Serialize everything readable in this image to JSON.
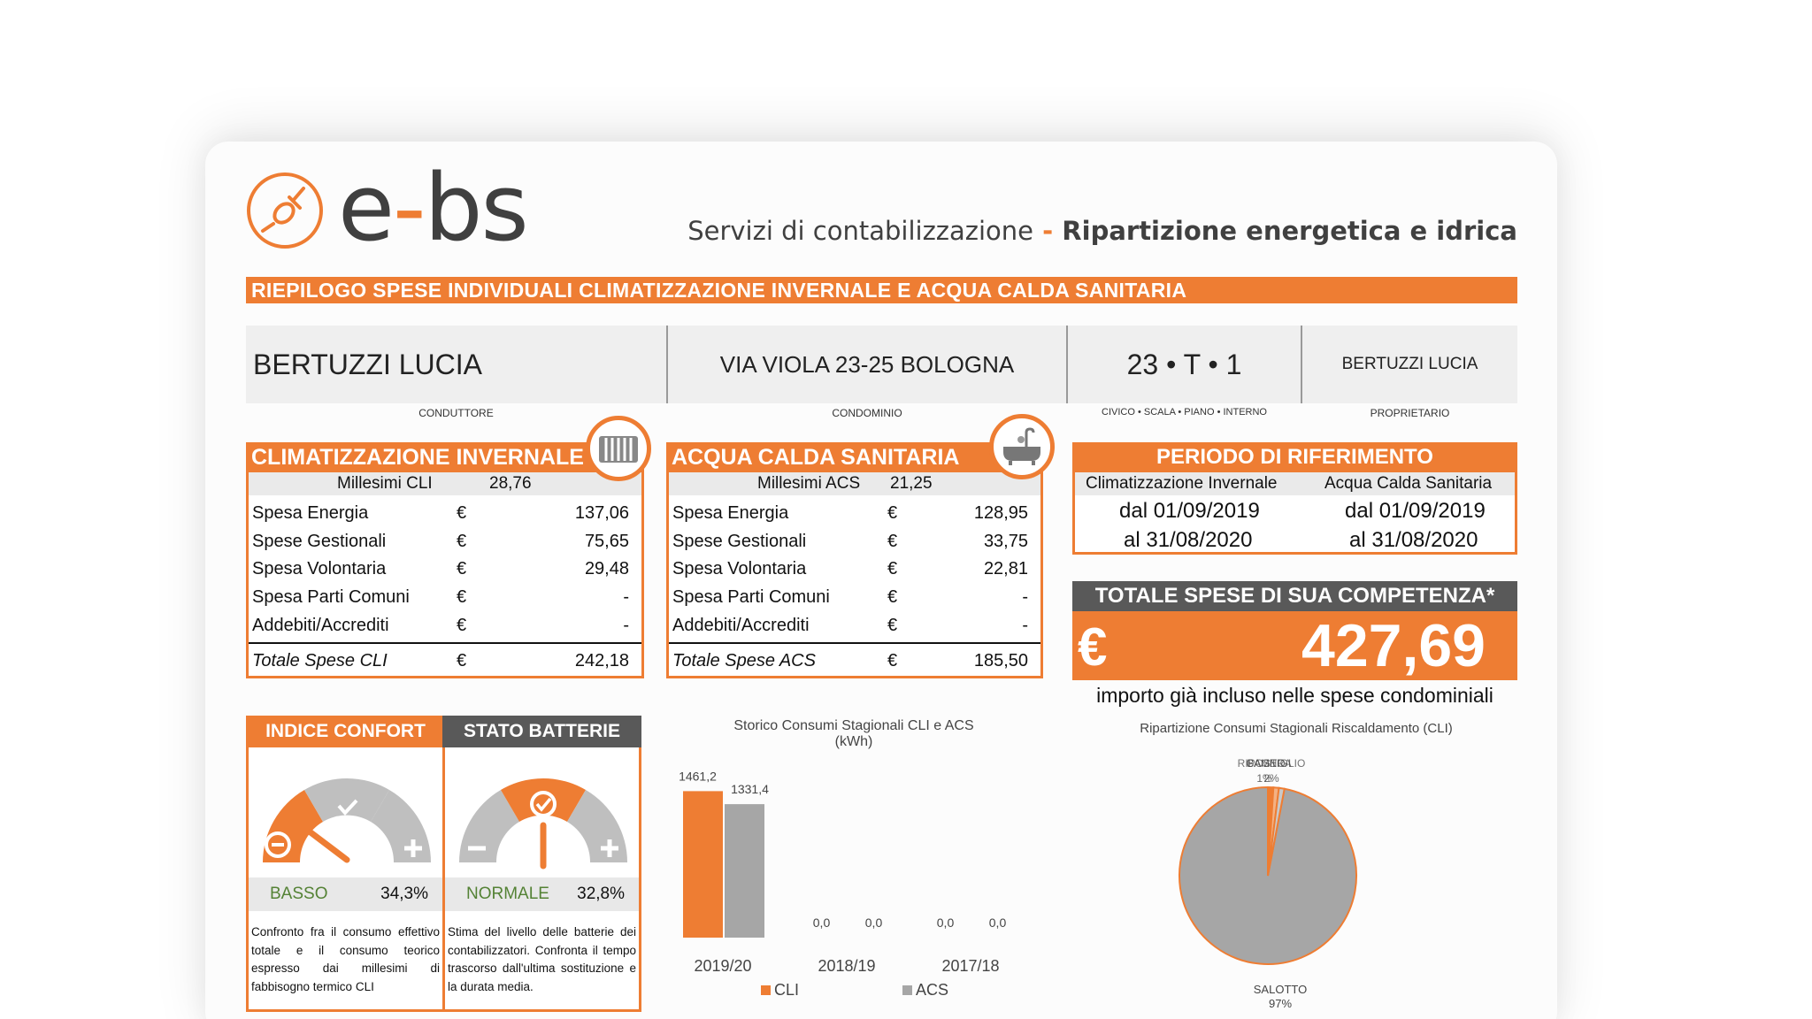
{
  "brand": {
    "logo_text": "e-bs",
    "tagline_part1": "Servizi di contabilizzazione",
    "tagline_sep": "-",
    "tagline_part2": "Ripartizione energetica e idrica"
  },
  "banner": "RIEPILOGO SPESE INDIVIDUALI CLIMATIZZAZIONE INVERNALE E ACQUA CALDA SANITARIA",
  "info": {
    "conduttore": "BERTUZZI LUCIA",
    "conduttore_label": "CONDUTTORE",
    "condominio": "VIA VIOLA 23-25 BOLOGNA",
    "condominio_label": "CONDOMINIO",
    "civico": "23 • T • 1",
    "civico_label": "CIVICO • SCALA • PIANO • INTERNO",
    "proprietario": "BERTUZZI LUCIA",
    "proprietario_label": "PROPRIETARIO"
  },
  "cli": {
    "title": "CLIMATIZZAZIONE INVERNALE",
    "icon": "radiator-icon",
    "millesimi_label": "Millesimi CLI",
    "millesimi_value": "28,76",
    "rows": [
      {
        "label": "Spesa Energia",
        "cur": "€",
        "value": "137,06"
      },
      {
        "label": "Spese Gestionali",
        "cur": "€",
        "value": "75,65"
      },
      {
        "label": "Spesa Volontaria",
        "cur": "€",
        "value": "29,48"
      },
      {
        "label": "Spesa Parti Comuni",
        "cur": "€",
        "value": "-"
      },
      {
        "label": "Addebiti/Accrediti",
        "cur": "€",
        "value": "-"
      }
    ],
    "total_label": "Totale Spese CLI",
    "total_cur": "€",
    "total_value": "242,18"
  },
  "acs": {
    "title": "ACQUA CALDA SANITARIA",
    "icon": "bathtub-icon",
    "millesimi_label": "Millesimi ACS",
    "millesimi_value": "21,25",
    "rows": [
      {
        "label": "Spesa Energia",
        "cur": "€",
        "value": "128,95"
      },
      {
        "label": "Spese Gestionali",
        "cur": "€",
        "value": "33,75"
      },
      {
        "label": "Spesa Volontaria",
        "cur": "€",
        "value": "22,81"
      },
      {
        "label": "Spesa Parti Comuni",
        "cur": "€",
        "value": "-"
      },
      {
        "label": "Addebiti/Accrediti",
        "cur": "€",
        "value": "-"
      }
    ],
    "total_label": "Totale Spese ACS",
    "total_cur": "€",
    "total_value": "185,50"
  },
  "periodo": {
    "title": "PERIODO DI RIFERIMENTO",
    "col1": "Climatizzazione Invernale",
    "col2": "Acqua Calda Sanitaria",
    "from1": "dal 01/09/2019",
    "to1": "al 31/08/2020",
    "from2": "dal 01/09/2019",
    "to2": "al 31/08/2020"
  },
  "totale": {
    "title": "TOTALE SPESE DI SUA COMPETENZA*",
    "currency": "€",
    "value": "427,69",
    "note": "importo già incluso nelle spese condominiali"
  },
  "confort": {
    "title": "INDICE CONFORT",
    "status": "BASSO",
    "percent": "34,3%",
    "desc": "Confronto fra il consumo effettivo totale e il consumo teorico espresso dai millesimi di fabbisogno termico CLI",
    "level": 0.343
  },
  "batterie": {
    "title": "STATO BATTERIE",
    "status": "NORMALE",
    "percent": "32,8%",
    "desc": "Stima del livello delle batterie dei contabilizzatori. Confronta il tempo trascorso dall'ultima sostituzione e la durata media.",
    "level": 0.5
  },
  "colors": {
    "accent": "#ee7d33",
    "grey_series": "#a6a6a6",
    "dark_head": "#595959",
    "status_green": "#548235"
  },
  "chart_data": [
    {
      "type": "bar",
      "title": "Storico Consumi Stagionali CLI e ACS",
      "subtitle": "(kWh)",
      "categories": [
        "2019/20",
        "2018/19",
        "2017/18"
      ],
      "series": [
        {
          "name": "CLI",
          "values": [
            1461.2,
            0.0,
            0.0
          ],
          "labels": [
            "1461,2",
            "0,0",
            "0,0"
          ]
        },
        {
          "name": "ACS",
          "values": [
            1331.4,
            0.0,
            0.0
          ],
          "labels": [
            "1331,4",
            "0,0",
            "0,0"
          ]
        }
      ],
      "ylim": [
        0,
        1500
      ]
    },
    {
      "type": "pie",
      "title": "Ripartizione Consumi Stagionali Riscaldamento (CLI)",
      "slices": [
        {
          "label": "SALOTTO",
          "pct_label": "97%",
          "value": 97
        },
        {
          "label": "CAMERA",
          "pct_label": "1%",
          "value": 1
        },
        {
          "label": "BAGNO",
          "pct_label": "1%",
          "value": 1
        },
        {
          "label": "RIPOSTIGLIO",
          "pct_label": "1%",
          "value": 1
        }
      ],
      "overlap_label_top": "BAGNO",
      "overlap_label_top2": "CAMERA",
      "overlap_label_top3": "RIPOSTIGLIO",
      "overlap_pct_top": "1%",
      "overlap_pct_top2": "2%"
    }
  ]
}
